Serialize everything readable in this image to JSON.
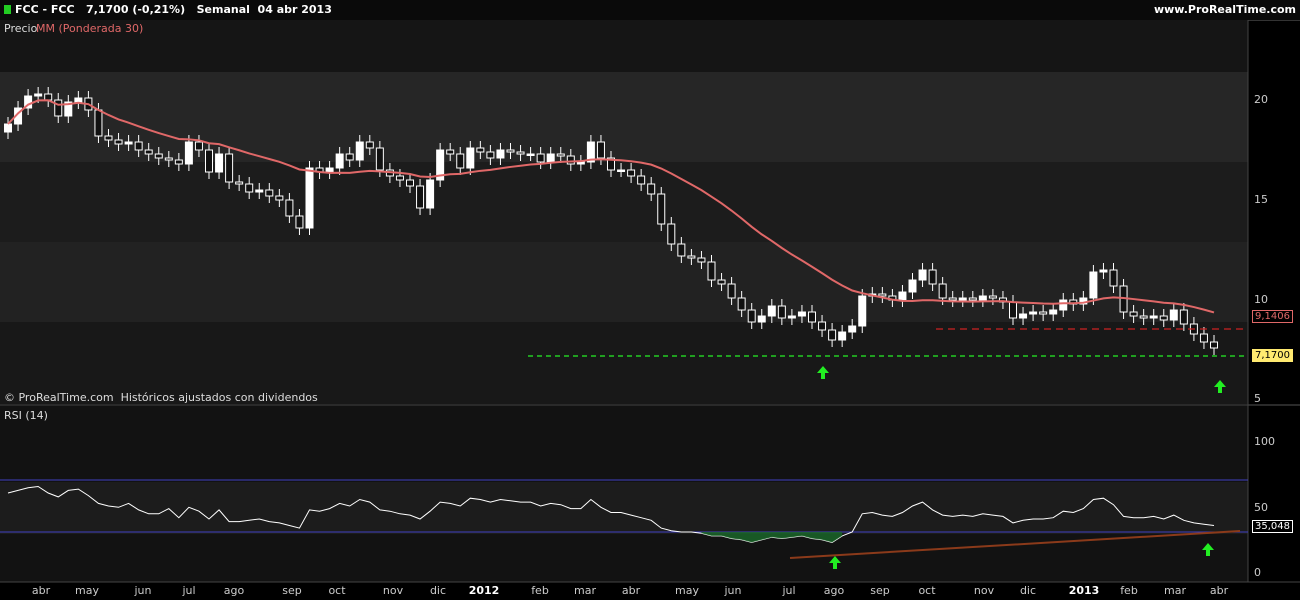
{
  "header": {
    "ticker": "FCC - FCC",
    "last": "7,1700 (-0,21%)",
    "period": "Semanal  04 abr 2013",
    "site": "www.ProRealTime.com"
  },
  "price_panel": {
    "label_price": "Precio",
    "label_ma": "MM (Ponderada 30)",
    "ma_tag": "9,1406",
    "last_tag": "7,1700",
    "footer": "© ProRealTime.com  Históricos ajustados con dividendos",
    "y_ticks": [
      "20",
      "15",
      "10",
      "5"
    ]
  },
  "rsi_panel": {
    "label": "RSI (14)",
    "value_tag": "35,048",
    "y_ticks": [
      "100",
      "50",
      "0"
    ]
  },
  "x_axis": [
    "abr",
    "may",
    "jun",
    "jul",
    "ago",
    "sep",
    "oct",
    "nov",
    "dic",
    "2012",
    "feb",
    "mar",
    "abr",
    "may",
    "jun",
    "jul",
    "ago",
    "sep",
    "oct",
    "nov",
    "dic",
    "2013",
    "feb",
    "mar",
    "abr"
  ],
  "colors": {
    "ma": "#e06868",
    "support": "#22cc22",
    "resistance": "#cc2222",
    "rsi_line": "#ffffff",
    "rsi_band": "#4040c0",
    "trend": "#8b3a1a",
    "arrow": "#22ee22"
  },
  "chart_data": [
    {
      "type": "candlestick",
      "title": "FCC - FCC",
      "ylim": [
        5,
        22
      ],
      "ma_label": "MM (Ponderada 30)",
      "close": [
        18.8,
        19.6,
        20.2,
        20.3,
        20.0,
        19.2,
        19.9,
        20.1,
        19.5,
        18.2,
        18.0,
        17.8,
        17.9,
        17.5,
        17.3,
        17.1,
        17.0,
        16.8,
        17.9,
        17.5,
        16.4,
        17.3,
        15.9,
        15.8,
        15.4,
        15.5,
        15.2,
        15.0,
        14.2,
        13.6,
        16.6,
        16.4,
        16.6,
        17.3,
        17.0,
        17.9,
        17.6,
        16.5,
        16.2,
        16.0,
        15.7,
        14.6,
        16.0,
        17.5,
        17.3,
        16.6,
        17.6,
        17.4,
        17.1,
        17.5,
        17.4,
        17.3,
        17.3,
        16.9,
        17.3,
        17.2,
        16.8,
        16.9,
        17.9,
        17.1,
        16.5,
        16.5,
        16.2,
        15.8,
        15.3,
        13.8,
        12.8,
        12.2,
        12.1,
        11.9,
        11.0,
        10.8,
        10.1,
        9.5,
        8.9,
        9.2,
        9.7,
        9.1,
        9.2,
        9.4,
        8.9,
        8.5,
        8.0,
        8.4,
        8.7,
        10.2,
        10.3,
        10.2,
        10.0,
        10.4,
        11.0,
        11.5,
        10.8,
        10.1,
        10.0,
        10.1,
        10.0,
        10.2,
        10.1,
        9.9,
        9.1,
        9.3,
        9.4,
        9.3,
        9.5,
        10.0,
        9.8,
        10.1,
        11.4,
        11.5,
        10.7,
        9.4,
        9.2,
        9.1,
        9.2,
        9.0,
        9.5,
        8.8,
        8.3,
        7.9,
        7.6
      ]
    },
    {
      "type": "line",
      "title": "RSI (14)",
      "ylim": [
        0,
        100
      ],
      "bands": [
        30,
        70
      ],
      "values": [
        60,
        62,
        64,
        65,
        60,
        57,
        62,
        63,
        58,
        52,
        50,
        49,
        52,
        47,
        44,
        44,
        48,
        41,
        49,
        46,
        40,
        47,
        38,
        38,
        39,
        40,
        38,
        37,
        35,
        33,
        47,
        46,
        48,
        52,
        50,
        55,
        53,
        47,
        46,
        44,
        43,
        40,
        46,
        53,
        52,
        50,
        56,
        55,
        53,
        55,
        54,
        53,
        53,
        50,
        52,
        51,
        48,
        48,
        55,
        49,
        45,
        45,
        43,
        41,
        39,
        33,
        31,
        30,
        30,
        29,
        27,
        27,
        25,
        24,
        22,
        24,
        26,
        25,
        26,
        27,
        25,
        24,
        22,
        27,
        30,
        44,
        45,
        43,
        42,
        45,
        50,
        53,
        47,
        43,
        42,
        43,
        42,
        44,
        43,
        42,
        37,
        39,
        40,
        40,
        41,
        46,
        45,
        48,
        55,
        56,
        51,
        42,
        41,
        41,
        42,
        40,
        43,
        39,
        37,
        36,
        35
      ]
    }
  ]
}
